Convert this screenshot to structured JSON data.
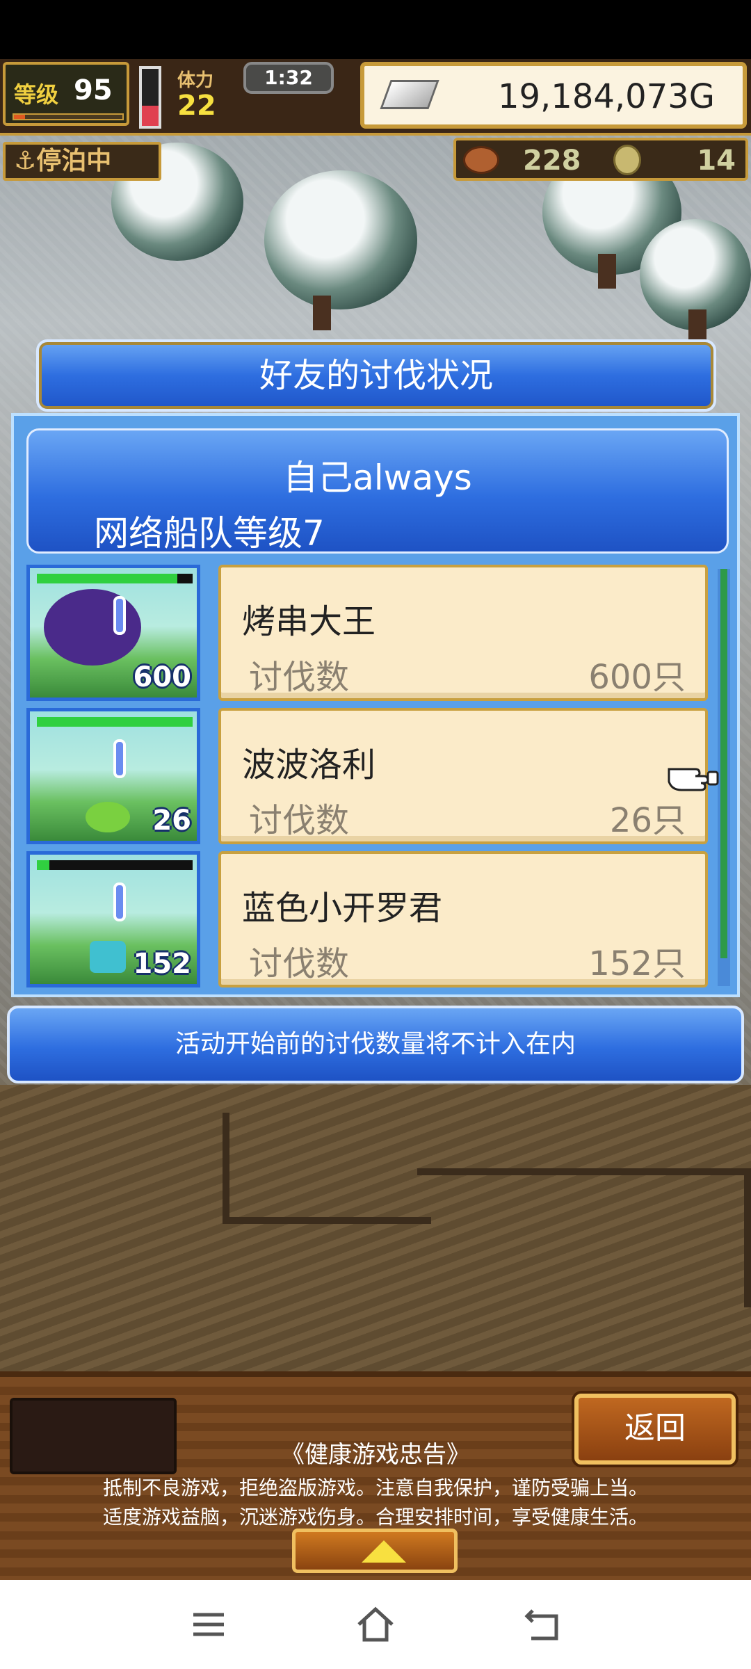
{
  "hud": {
    "level_label": "等级",
    "level_value": "95",
    "level_progress": 0.1,
    "stamina_label": "体力",
    "stamina_value": "22",
    "stamina_level": 0.35,
    "timer": "1:32",
    "money_icon": "silver-ingot-icon",
    "money": "19,184,073G",
    "status": "⚓停泊中",
    "resource_a_icon": "meat-icon",
    "resource_a_value": "228",
    "resource_b_icon": "medal-icon",
    "resource_b_value": "14"
  },
  "dialog": {
    "title": "好友的讨伐状况",
    "owner_name": "自己always",
    "fleet_level": "网络船队等级7",
    "notice": "活动开始前的讨伐数量将不计入在内"
  },
  "friends": [
    {
      "name": "烤串大王",
      "kill_label": "讨伐数",
      "kills": "600只",
      "thumb_count": "600",
      "hp": 0.9
    },
    {
      "name": "波波洛利",
      "kill_label": "讨伐数",
      "kills": "26只",
      "thumb_count": "26",
      "hp": 1.0
    },
    {
      "name": "蓝色小开罗君",
      "kill_label": "讨伐数",
      "kills": "152只",
      "thumb_count": "152",
      "hp": 0.08
    }
  ],
  "bottom": {
    "back_label": "返回",
    "advisory_title": "《健康游戏忠告》",
    "advisory_line1": "抵制不良游戏，拒绝盗版游戏。注意自我保护，谨防受骗上当。",
    "advisory_line2": "适度游戏益脑，沉迷游戏伤身。合理安排时间，享受健康生活。"
  },
  "sysnav": {
    "menu_icon": "menu-icon",
    "home_icon": "home-icon",
    "back_icon": "back-icon"
  },
  "colors": {
    "panel_blue": "#2e6ee0",
    "card_cream": "#fbebc9",
    "hud_gold": "#c79a3a"
  }
}
